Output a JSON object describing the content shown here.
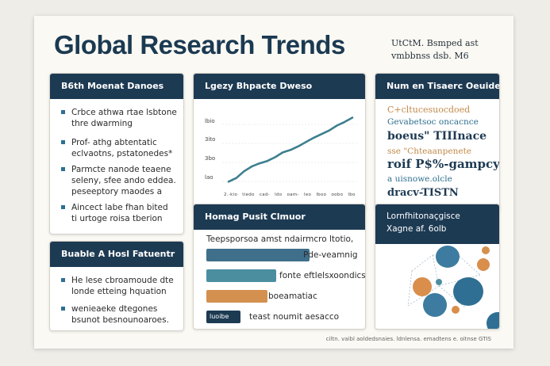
{
  "poster": {
    "title": "Global Research Trends",
    "corner_note": [
      "UtCtM.  Bsmped ast",
      "vmbbnss  dsb. M6"
    ],
    "footer": "ciltn.  vaibl aoldedsnaies. ldnlensa. emadtens  e. oitnse GTIS"
  },
  "cards": {
    "key_findings": {
      "title": "B6th Moenat Danoes",
      "bullets": [
        [
          "Crbce athwa rtae lsbtone",
          "thre dwarming"
        ],
        [
          "Prof- athg abtentatic",
          "eclvaotns, pstatonedes*"
        ],
        [
          "Parmcte nanode teaene",
          "seleny, sfee ando eddea.",
          "peseeptory maodes a"
        ],
        [
          "Aincect labe fhan bited",
          "ti urtoge roisa tberion"
        ]
      ]
    },
    "future": {
      "title": "Buable A Hosl Fatuentr",
      "bullets": [
        [
          "He lese cbroamoude dte",
          "londe etteing hquation"
        ],
        [
          "wenieaeke dtegones",
          "bsunot besnounoaroes."
        ]
      ]
    },
    "trend_chart": {
      "title": "Lgezy Bhpacte Dweso",
      "tick_labels": [
        "lbio",
        "3ito",
        "3bo",
        "lao"
      ],
      "x_tick_labels": [
        "2.-kio",
        "tiedo",
        "cad-",
        "ldo",
        "oam-",
        "leo",
        "lboo",
        "oobo",
        "lbo"
      ]
    },
    "keywords": {
      "title": "Num en Tisaerc Oeuide",
      "items": [
        "C+cltucesuocdoed",
        "Gevabetsoc oncacnce",
        "boeus\" TIIInace",
        "sse \"Chteaanpenete",
        "roif P$%-gampcy",
        "a uisnowe.olcle",
        "dracv-TISTN"
      ],
      "colors": [
        "#c28a4a",
        "#2f6f8e",
        "#1d3a53",
        "#c28a4a",
        "#1d3a53",
        "#2f6f8e",
        "#1d3a53"
      ]
    },
    "funding": {
      "title": "Homag Pusit Clmuor",
      "subtitle": "Teepsporsoa amst ndairmcro ltotio,",
      "bars": [
        {
          "inner": "",
          "label": "Pde-veamnig",
          "color": "#3f6f8b",
          "fraction": 0.81
        },
        {
          "inner": "",
          "label": "fonte eftlelsxoondics",
          "color": "#4b8ea0",
          "fraction": 0.55
        },
        {
          "inner": "",
          "label": "boeamatiac",
          "color": "#d4904f",
          "fraction": 0.48
        },
        {
          "inner": "luoibe",
          "label": "teast noumit aesacco",
          "color": "#1d3a53",
          "fraction": 0.27
        }
      ]
    },
    "network": {
      "title": "Lornfhitonaçgisce",
      "subtitle": "Xagne af. 6olb"
    }
  },
  "chart_data": {
    "type": "line",
    "x": [
      0,
      1,
      2,
      3,
      4,
      5,
      6,
      7,
      8,
      9,
      10,
      11,
      12,
      13,
      14,
      15,
      16
    ],
    "series": [
      {
        "values": [
          10,
          16,
          27,
          35,
          40,
          44,
          50,
          58,
          62,
          68,
          75,
          82,
          88,
          94,
          102,
          108,
          115
        ]
      }
    ],
    "ylim": [
      0,
      130
    ],
    "xlim": [
      0,
      16
    ],
    "color": "#3d7f8e",
    "grid": true
  }
}
